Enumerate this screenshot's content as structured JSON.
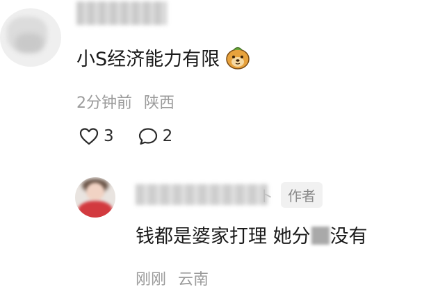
{
  "comment": {
    "text": "小S经济能力有限",
    "emoji": "bear-face-emoji",
    "time": "2分钟前",
    "location": "陕西",
    "likes": "3",
    "replies": "2"
  },
  "reply": {
    "badge": "作者",
    "reply_mark": "卜",
    "text_before": "钱都是婆家打理 她分",
    "text_after": "没有",
    "time": "刚刚",
    "location": "云南"
  },
  "colors": {
    "text": "#1b1b1b",
    "meta": "#9b9b9b",
    "badge_bg": "#f1f1f1"
  }
}
